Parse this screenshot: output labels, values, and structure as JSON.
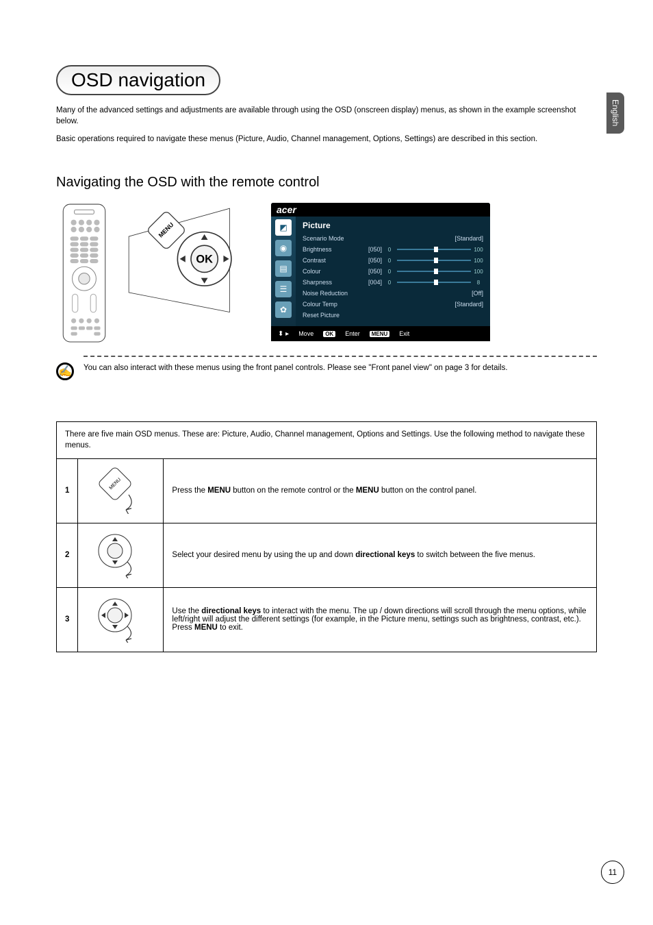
{
  "sideTab": "English",
  "title": "OSD navigation",
  "intro": {
    "p1": "Many of the advanced settings and adjustments are available through using the OSD (onscreen display) menus, as shown in the example screenshot below.",
    "p2": "Basic operations required to navigate these menus (Picture, Audio, Channel management, Options, Settings) are described in this section."
  },
  "subheading": "Navigating the OSD with the remote control",
  "callout": {
    "menuLabel": "MENU",
    "okLabel": "OK"
  },
  "osd": {
    "brand": "acer",
    "title": "Picture",
    "rows": [
      {
        "label": "Scenario Mode",
        "type": "value",
        "value": "[Standard]"
      },
      {
        "label": "Brightness",
        "type": "slider",
        "val": "[050]",
        "lo": "0",
        "hi": "100",
        "pos": 50
      },
      {
        "label": "Contrast",
        "type": "slider",
        "val": "[050]",
        "lo": "0",
        "hi": "100",
        "pos": 50
      },
      {
        "label": "Colour",
        "type": "slider",
        "val": "[050]",
        "lo": "0",
        "hi": "100",
        "pos": 50
      },
      {
        "label": "Sharpness",
        "type": "slider",
        "val": "[004]",
        "lo": "0",
        "hi": "8",
        "pos": 50
      },
      {
        "label": "Noise Reduction",
        "type": "value",
        "value": "[Off]"
      },
      {
        "label": "Colour Temp",
        "type": "value",
        "value": "[Standard]"
      },
      {
        "label": "Reset Picture",
        "type": "none"
      }
    ],
    "footer": {
      "move": "Move",
      "ok": "OK",
      "enter": "Enter",
      "menu": "MENU",
      "exit": "Exit"
    }
  },
  "note": "You can also interact with these menus using the front panel controls. Please see \"Front panel view\" on page 3 for details.",
  "table": {
    "intro": "There are five main OSD menus. These are: Picture, Audio, Channel management, Options and Settings. Use the following method to navigate these menus.",
    "rows": [
      {
        "n": "1",
        "pre": "Press the ",
        "b1": "MENU",
        "mid": " button on the remote control or the ",
        "b2": "MENU",
        "post": " button on the control panel."
      },
      {
        "n": "2",
        "pre": "Select your desired menu by using the up and down ",
        "b1": "directional keys",
        "mid": " to switch between the five menus.",
        "b2": "",
        "post": ""
      },
      {
        "n": "3",
        "pre": "Use the ",
        "b1": "directional keys",
        "mid": " to interact with the menu. The up / down directions will scroll through the menu options, while left/right will adjust the different settings (for example, in the Picture menu, settings such as brightness, contrast, etc.). Press ",
        "b2": "MENU",
        "post": " to exit."
      }
    ]
  },
  "pageNumber": "11"
}
